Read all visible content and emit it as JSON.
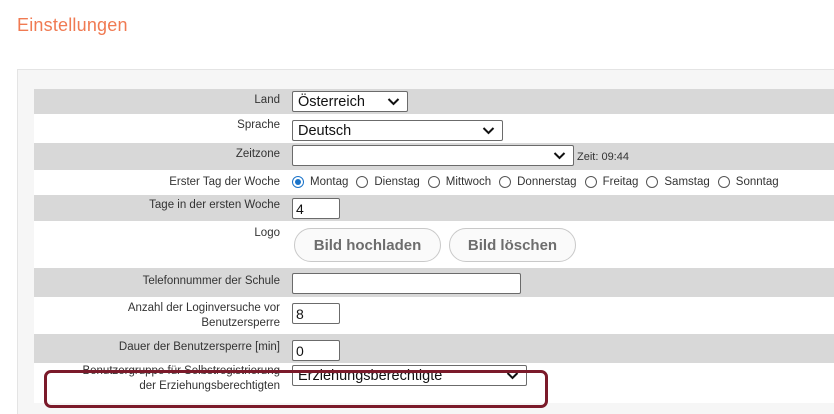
{
  "page": {
    "title": "Einstellungen"
  },
  "form": {
    "land": {
      "label": "Land",
      "value": "Österreich"
    },
    "sprache": {
      "label": "Sprache",
      "value": "Deutsch"
    },
    "zeitzone": {
      "label": "Zeitzone",
      "value": "",
      "time_text": "Zeit: 09:44"
    },
    "first_day": {
      "label": "Erster Tag der Woche",
      "options": [
        "Montag",
        "Dienstag",
        "Mittwoch",
        "Donnerstag",
        "Freitag",
        "Samstag",
        "Sonntag"
      ],
      "selected": "Montag"
    },
    "first_week_days": {
      "label": "Tage in der ersten Woche",
      "value": "4"
    },
    "logo": {
      "label": "Logo",
      "upload_label": "Bild hochladen",
      "delete_label": "Bild löschen"
    },
    "phone": {
      "label": "Telefonnummer der Schule",
      "value": ""
    },
    "login_attempts": {
      "label_line1": "Anzahl der Loginversuche vor",
      "label_line2": "Benutzersperre",
      "value": "8"
    },
    "lock_duration": {
      "label": "Dauer der Benutzersperre [min]",
      "value": "0"
    },
    "self_registration": {
      "label_line1": "Benutzergruppe für Selbstregistrierung",
      "label_line2": "der Erziehungsberechtigten",
      "value": "Erziehungsberechtigte"
    }
  },
  "colors": {
    "title": "#f07a52",
    "highlight": "#7b1a2a",
    "radio_selected": "#1a73c9",
    "row_shaded": "#d8d8d8"
  },
  "icons": {
    "dropdown": "chevron-down-icon"
  }
}
